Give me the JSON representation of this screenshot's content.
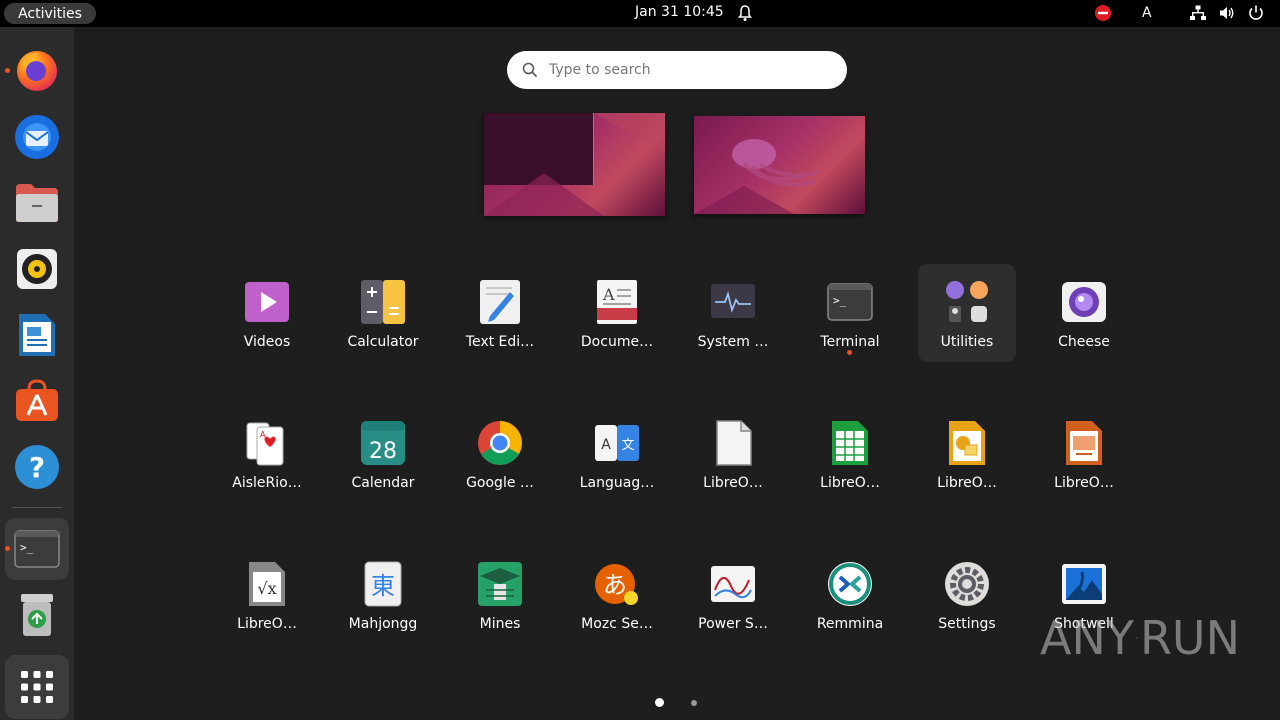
{
  "topbar": {
    "activities_label": "Activities",
    "clock": "Jan 31  10:45",
    "keyboard_layout": "A"
  },
  "search": {
    "placeholder": "Type to search"
  },
  "dock": {
    "items": [
      {
        "icon": "firefox-icon",
        "running": true
      },
      {
        "icon": "thunderbird-icon",
        "running": false
      },
      {
        "icon": "files-icon",
        "running": false
      },
      {
        "icon": "rhythmbox-icon",
        "running": false
      },
      {
        "icon": "libreoffice-writer-icon",
        "running": false
      },
      {
        "icon": "app-center-icon",
        "running": false
      },
      {
        "icon": "help-icon",
        "running": false
      },
      {
        "icon": "terminal-icon",
        "running": true
      },
      {
        "icon": "trash-icon",
        "running": false
      },
      {
        "icon": "show-apps-icon",
        "running": false
      }
    ]
  },
  "apps": [
    {
      "label": "Videos",
      "icon": "videos-icon"
    },
    {
      "label": "Calculator",
      "icon": "calculator-icon"
    },
    {
      "label": "Text Edi…",
      "icon": "text-editor-icon"
    },
    {
      "label": "Docume…",
      "icon": "document-viewer-icon"
    },
    {
      "label": "System …",
      "icon": "system-monitor-icon"
    },
    {
      "label": "Terminal",
      "icon": "terminal-icon",
      "running": true
    },
    {
      "label": "Utilities",
      "icon": "utilities-folder-icon",
      "highlighted": true
    },
    {
      "label": "Cheese",
      "icon": "cheese-icon"
    },
    {
      "label": "AisleRio…",
      "icon": "aisleriot-icon"
    },
    {
      "label": "Calendar",
      "icon": "calendar-icon",
      "day": "28"
    },
    {
      "label": "Google …",
      "icon": "chrome-icon"
    },
    {
      "label": "Languag…",
      "icon": "language-icon"
    },
    {
      "label": "LibreO…",
      "icon": "libreoffice-icon"
    },
    {
      "label": "LibreO…",
      "icon": "libreoffice-calc-icon"
    },
    {
      "label": "LibreO…",
      "icon": "libreoffice-draw-icon"
    },
    {
      "label": "LibreO…",
      "icon": "libreoffice-impress-icon"
    },
    {
      "label": "LibreO…",
      "icon": "libreoffice-math-icon"
    },
    {
      "label": "Mahjongg",
      "icon": "mahjongg-icon",
      "glyph": "東"
    },
    {
      "label": "Mines",
      "icon": "mines-icon"
    },
    {
      "label": "Mozc Se…",
      "icon": "mozc-icon",
      "glyph": "あ"
    },
    {
      "label": "Power S…",
      "icon": "power-statistics-icon"
    },
    {
      "label": "Remmina",
      "icon": "remmina-icon"
    },
    {
      "label": "Settings",
      "icon": "settings-icon"
    },
    {
      "label": "Shotwell",
      "icon": "shotwell-icon"
    }
  ],
  "pager": {
    "pages": 2,
    "current": 1
  },
  "watermark": {
    "text_left": "ANY",
    "text_right": "RUN"
  },
  "colors": {
    "accent": "#e95420",
    "panel": "#000000",
    "dock": "#2b2b2b"
  }
}
